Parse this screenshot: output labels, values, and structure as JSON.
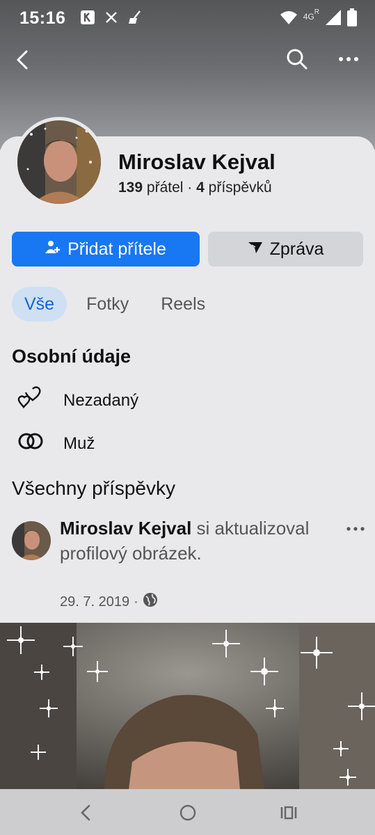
{
  "status_bar": {
    "time": "15:16",
    "network": "4G",
    "roaming": "R",
    "icons": [
      "notification-k-icon",
      "x-app-icon",
      "broom-icon",
      "wifi-icon",
      "signal-icon",
      "battery-icon"
    ]
  },
  "nav": {
    "icons": [
      "back-arrow-icon",
      "search-icon",
      "more-icon"
    ]
  },
  "profile": {
    "name": "Miroslav Kejval",
    "friends_count": "139",
    "friends_label": "přátel",
    "separator": "·",
    "posts_count": "4",
    "posts_label": "příspěvků"
  },
  "actions": {
    "add_friend": "Přidat přítele",
    "message": "Zpráva"
  },
  "tabs": [
    {
      "label": "Vše",
      "active": true
    },
    {
      "label": "Fotky",
      "active": false
    },
    {
      "label": "Reels",
      "active": false
    }
  ],
  "personal_info": {
    "title": "Osobní údaje",
    "items": [
      {
        "icon": "hearts-icon",
        "text": "Nezadaný"
      },
      {
        "icon": "rings-icon",
        "text": "Muž"
      }
    ]
  },
  "posts": {
    "title": "Všechny příspěvky",
    "items": [
      {
        "author": "Miroslav Kejval",
        "action": " si aktualizoval profilový obrázek.",
        "date": "29. 7. 2019",
        "date_separator": "·",
        "privacy_icon": "globe-icon"
      }
    ]
  },
  "colors": {
    "primary": "#1877f2",
    "secondary_button": "#d3d5d8",
    "active_tab_bg": "#cfe0f5",
    "active_tab_text": "#1464d6",
    "background": "#e9e9eb"
  }
}
